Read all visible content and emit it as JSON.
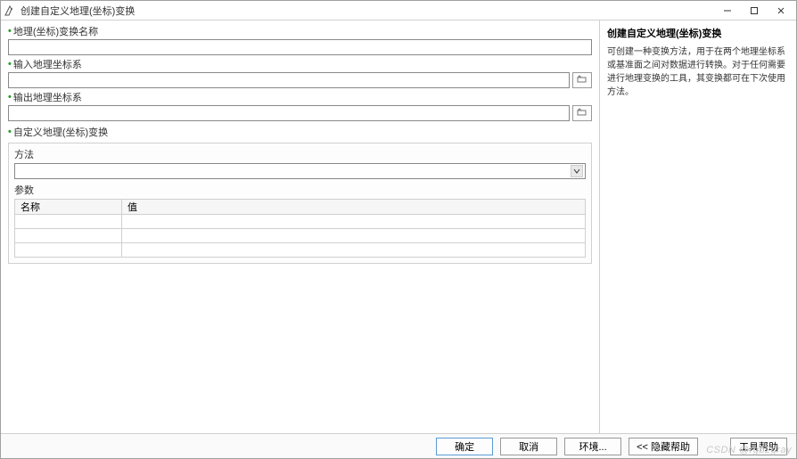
{
  "window": {
    "title": "创建自定义地理(坐标)变换"
  },
  "left": {
    "field_transform_name": {
      "label": "地理(坐标)变换名称",
      "value": ""
    },
    "field_input_cs": {
      "label": "输入地理坐标系",
      "value": ""
    },
    "field_output_cs": {
      "label": "输出地理坐标系",
      "value": ""
    },
    "section_custom": {
      "label": "自定义地理(坐标)变换"
    },
    "method": {
      "label": "方法",
      "selected": ""
    },
    "params": {
      "label": "参数",
      "columns": {
        "name": "名称",
        "value": "值"
      },
      "rows": [
        {
          "name": "",
          "value": ""
        },
        {
          "name": "",
          "value": ""
        },
        {
          "name": "",
          "value": ""
        }
      ]
    }
  },
  "right": {
    "title": "创建自定义地理(坐标)变换",
    "description": "可创建一种变换方法，用于在两个地理坐标系或基准面之间对数据进行转换。对于任何需要进行地理变换的工具，其变换都可在下次使用方法。"
  },
  "buttons": {
    "ok": "确定",
    "cancel": "取消",
    "environments": "环境...",
    "hide_help": "<<  隐藏帮助",
    "tool_help": "工具帮助"
  },
  "watermark": "CSDN @rgb2gray"
}
